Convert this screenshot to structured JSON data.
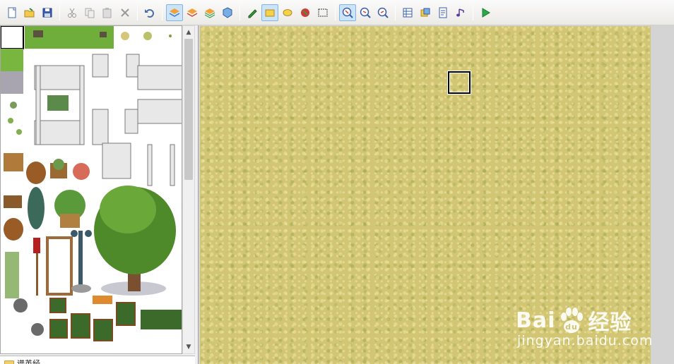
{
  "toolbar": {
    "groups": [
      [
        "new-icon",
        "open-icon",
        "save-icon"
      ],
      [
        "cut-icon",
        "copy-icon",
        "paste-icon",
        "delete-icon"
      ],
      [
        "undo-icon"
      ],
      [
        "layer1-icon",
        "layer2-icon",
        "layer3-icon",
        "event-layer-icon"
      ],
      [
        "pencil-icon",
        "rectangle-icon",
        "ellipse-icon",
        "flood-fill-icon",
        "select-icon"
      ],
      [
        "zoom-1x-icon",
        "zoom-2x-icon",
        "zoom-4x-icon"
      ],
      [
        "database-icon",
        "materials-icon",
        "script-editor-icon",
        "sound-test-icon"
      ],
      [
        "playtest-icon"
      ]
    ],
    "active": [
      "layer1-icon",
      "rectangle-icon",
      "zoom-1x-icon"
    ]
  },
  "map_tree": {
    "item_label": "谱英经"
  },
  "watermark": {
    "brand_bai": "Bai",
    "brand_du": "du",
    "brand_cn": "经验",
    "url": "jingyan.baidu.com"
  },
  "colors": {
    "accent": "#7eb4ea",
    "grass": "#6fae3a",
    "map_ground": "#d2c674"
  }
}
